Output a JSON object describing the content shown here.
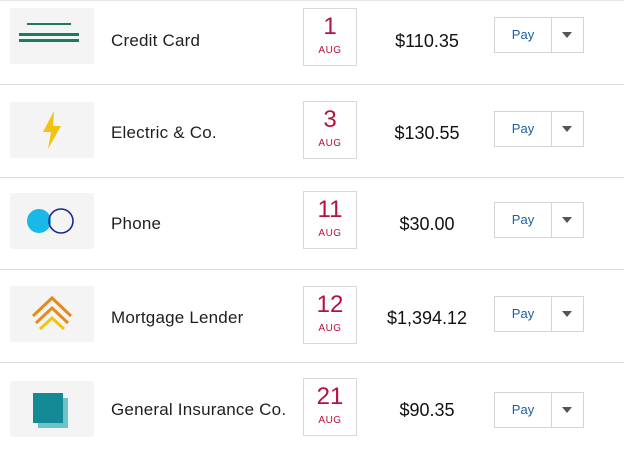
{
  "bills": [
    {
      "payee": "Credit Card",
      "day": "1",
      "month": "AUG",
      "amount": "$110.35",
      "pay_label": "Pay",
      "logo": "credit-card-logo"
    },
    {
      "payee": "Electric & Co.",
      "day": "3",
      "month": "AUG",
      "amount": "$130.55",
      "pay_label": "Pay",
      "logo": "lightning-bolt-logo"
    },
    {
      "payee": "Phone",
      "day": "11",
      "month": "AUG",
      "amount": "$30.00",
      "pay_label": "Pay",
      "logo": "phone-circles-logo"
    },
    {
      "payee": "Mortgage Lender",
      "day": "12",
      "month": "AUG",
      "amount": "$1,394.12",
      "pay_label": "Pay",
      "logo": "mortgage-chevrons-logo"
    },
    {
      "payee": "General Insurance Co.",
      "day": "21",
      "month": "AUG",
      "amount": "$90.35",
      "pay_label": "Pay",
      "logo": "insurance-squares-logo"
    }
  ],
  "colors": {
    "date_accent": "#b5123e",
    "pay_text": "#1b5ea8",
    "credit_card_green": "#1a7a63",
    "electric_yellow": "#f2c40f",
    "phone_cyan": "#19b8e6",
    "phone_navy": "#1d2a8a",
    "mortgage_orange": "#e58a1b",
    "mortgage_yellow": "#f2c40f",
    "insurance_teal": "#138a95",
    "insurance_light": "#6cc4cb"
  }
}
